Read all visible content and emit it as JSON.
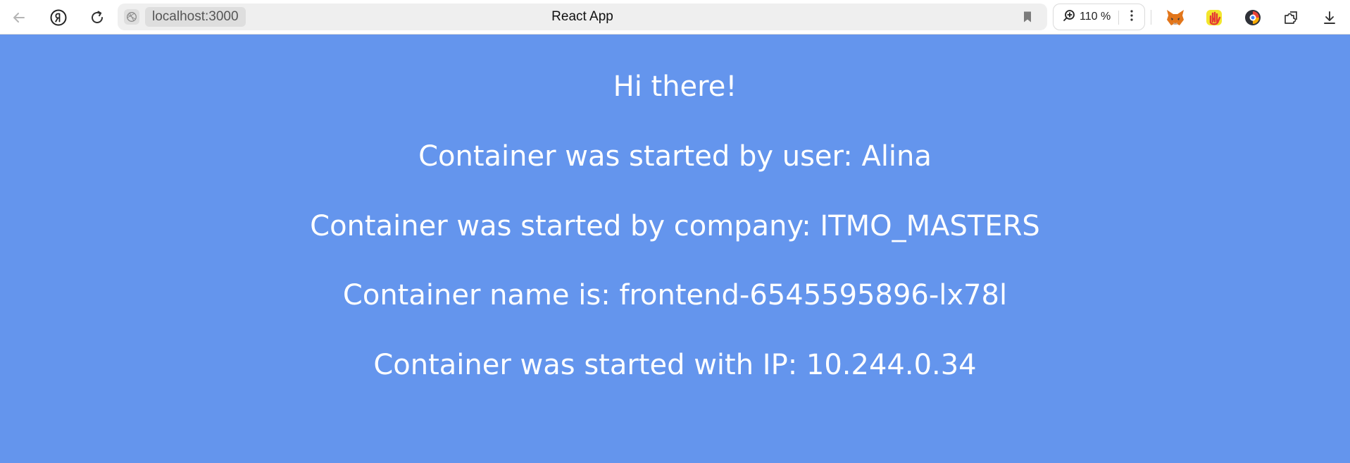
{
  "browser": {
    "address": "localhost:3000",
    "page_title": "React App",
    "zoom_level": "110 %",
    "icons": [
      "back-arrow-icon",
      "yandex-icon",
      "reload-icon",
      "site-info-icon",
      "bookmark-icon",
      "zoom-icon",
      "more-icon",
      "metamask-extension-icon",
      "hand-extension-icon",
      "circle-extension-icon",
      "extensions-icon",
      "download-icon"
    ]
  },
  "page": {
    "background": "#6495ED",
    "greeting": "Hi there!",
    "user_line": "Container was started by user: Alina",
    "company_line": "Container was started by company: ITMO_MASTERS",
    "name_line": "Container name is: frontend-6545595896-lx78l",
    "ip_line": "Container was started with IP: 10.244.0.34"
  }
}
